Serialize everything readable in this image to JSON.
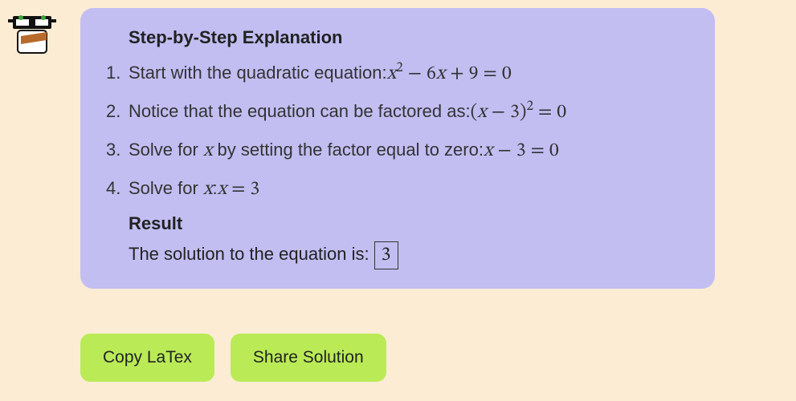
{
  "explanation": {
    "heading": "Step-by-Step Explanation",
    "steps": [
      {
        "num": "1.",
        "text": "Start with the quadratic equation: ",
        "math": "x² − 6x + 9 = 0"
      },
      {
        "num": "2.",
        "text": "Notice that the equation can be factored as: ",
        "math": "(x − 3)² = 0"
      },
      {
        "num": "3.",
        "text": "Solve for x by setting the factor equal to zero: ",
        "math": "x − 3 = 0"
      },
      {
        "num": "4.",
        "text": "Solve for x: ",
        "math": "x = 3"
      }
    ],
    "result_heading": "Result",
    "result_text": "The solution to the equation is: ",
    "result_value": "3"
  },
  "buttons": {
    "copy": "Copy LaTex",
    "share": "Share Solution"
  }
}
